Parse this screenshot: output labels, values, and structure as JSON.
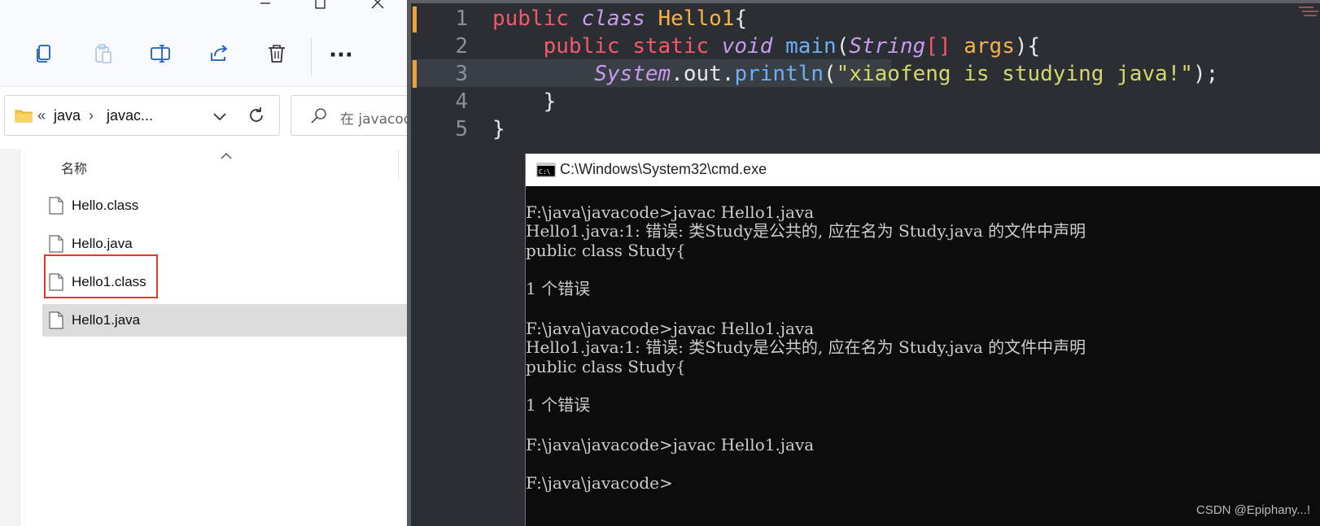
{
  "explorer": {
    "toolbar": {
      "copy_icon": "copy-icon",
      "paste_icon": "paste-icon",
      "rename_icon": "rename-icon",
      "share_icon": "share-icon",
      "delete_icon": "trash-icon",
      "more_label": "···"
    },
    "address": {
      "chevron": "«",
      "crumb1": "java",
      "separator": "›",
      "crumb2": "javac..."
    },
    "search": {
      "placeholder": "在 javacode"
    },
    "column_header": "名称",
    "files": [
      {
        "name": "Hello.class"
      },
      {
        "name": "Hello.java"
      },
      {
        "name": "Hello1.class"
      },
      {
        "name": "Hello1.java"
      }
    ],
    "highlight_color": "#e03a2f"
  },
  "editor": {
    "line_numbers": [
      "1",
      "2",
      "3",
      "4",
      "5"
    ],
    "colors": {
      "keyword": "#f7566b",
      "class": "#f8b04a",
      "function": "#6bb0f5",
      "string": "#d3d86a",
      "italic": "#c79af0"
    },
    "tokens": {
      "l1_public": "public",
      "l1_class": "class",
      "l1_name": "Hello1",
      "l1_brace": "{",
      "l2_public": "public",
      "l2_static": "static",
      "l2_void": "void",
      "l2_main": "main",
      "l2_paren": "(",
      "l2_string": "String",
      "l2_brackets": "[]",
      "l2_args": "args",
      "l2_close": "){",
      "l3_system": "System",
      "l3_dot1": ".",
      "l3_out": "out",
      "l3_dot2": ".",
      "l3_println": "println",
      "l3_paren": "(",
      "l3_str": "\"xiaofeng is studying java!\"",
      "l3_close": ");",
      "l4_brace": "}",
      "l5_brace": "}"
    }
  },
  "cmd": {
    "title": "C:\\Windows\\System32\\cmd.exe",
    "lines": [
      "F:\\java\\javacode>javac Hello1.java",
      "Hello1.java:1: 错误: 类Study是公共的, 应在名为 Study.java 的文件中声明",
      "public class Study{",
      "1 个错误",
      "F:\\java\\javacode>javac Hello1.java",
      "Hello1.java:1: 错误: 类Study是公共的, 应在名为 Study.java 的文件中声明",
      "public class Study{",
      "1 个错误",
      "F:\\java\\javacode>javac Hello1.java",
      "F:\\java\\javacode>"
    ]
  },
  "watermark": "CSDN @Epiphany...!"
}
